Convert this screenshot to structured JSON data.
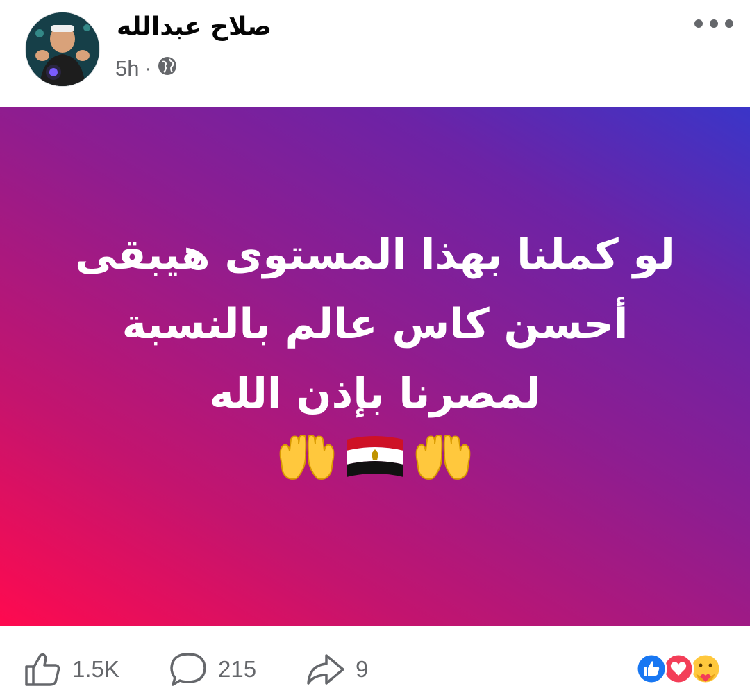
{
  "post": {
    "author": "صلاح عبدالله",
    "time": "5h",
    "visibility_icon": "globe-icon",
    "lines": [
      "لو كملنا بهذا المستوى هيبقى",
      "أحسن كاس عالم بالنسبة",
      "لمصرنا بإذن الله"
    ],
    "emojis": [
      "open-hands-icon",
      "egypt-flag-icon",
      "open-hands-icon"
    ],
    "background_colors": [
      "#ff0a4f",
      "#8e1d90",
      "#3a35c8"
    ]
  },
  "stats": {
    "likes": "1.5K",
    "comments": "215",
    "shares": "9"
  },
  "reaction_icons": [
    "like-reaction-icon",
    "love-reaction-icon",
    "care-reaction-icon"
  ],
  "colors": {
    "like_blue": "#1877f2",
    "love_red": "#f33e58",
    "muted": "#65676b"
  }
}
